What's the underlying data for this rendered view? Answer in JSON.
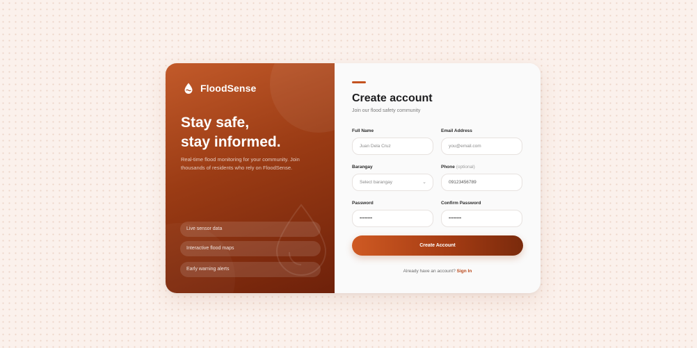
{
  "brand": {
    "name": "FloodSense",
    "icon": "flood-drop-logo-icon"
  },
  "hero": {
    "title_line1": "Stay safe,",
    "title_line2": "stay informed.",
    "description": "Real-time flood monitoring for your community. Join thousands of residents who rely on FloodSense."
  },
  "features": [
    {
      "label": "Live sensor data"
    },
    {
      "label": "Interactive flood maps"
    },
    {
      "label": "Early warning alerts"
    }
  ],
  "form": {
    "title": "Create account",
    "subtitle": "Join our flood safety community",
    "fields": {
      "full_name": {
        "label": "Full Name",
        "placeholder": "Juan Dela Cruz"
      },
      "email": {
        "label": "Email Address",
        "placeholder": "you@email.com"
      },
      "barangay": {
        "label": "Barangay",
        "placeholder": "Select barangay"
      },
      "phone": {
        "label": "Phone",
        "optional": "(optional)",
        "placeholder": "09123456789"
      },
      "password": {
        "label": "Password",
        "placeholder": "••••••••"
      },
      "confirm_password": {
        "label": "Confirm Password",
        "placeholder": "••••••••"
      }
    },
    "submit_label": "Create Account",
    "signin_prompt": "Already have an account?",
    "signin_link": "Sign In"
  },
  "colors": {
    "accent": "#c4521f",
    "panel_dark": "#6e210a",
    "background": "#fbf1ec"
  }
}
